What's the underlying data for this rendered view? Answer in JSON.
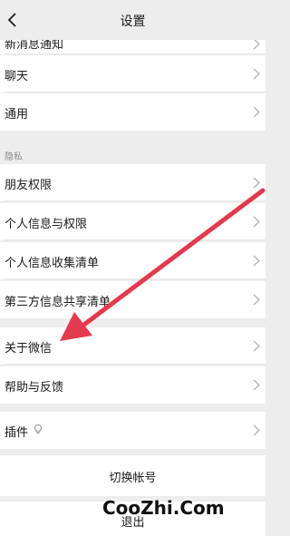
{
  "header": {
    "title": "设置",
    "back_icon": "chevron-left-icon"
  },
  "general_group": {
    "partial_item": "新消息通知",
    "items": [
      {
        "label": "聊天"
      },
      {
        "label": "通用"
      }
    ]
  },
  "privacy_group": {
    "section_label": "隐私",
    "items": [
      {
        "label": "朋友权限"
      },
      {
        "label": "个人信息与权限"
      },
      {
        "label": "个人信息收集清单"
      },
      {
        "label": "第三方信息共享清单"
      }
    ]
  },
  "about_group": {
    "items": [
      {
        "label": "关于微信"
      },
      {
        "label": "帮助与反馈"
      }
    ]
  },
  "plugin_group": {
    "label": "插件",
    "icon": "plugin-icon"
  },
  "switch_account": {
    "label": "切换帐号"
  },
  "logout": {
    "label": "退出"
  },
  "watermark": {
    "text": "CooZhi.Com"
  },
  "annotation": {
    "arrow_color": "#e23a4e"
  }
}
